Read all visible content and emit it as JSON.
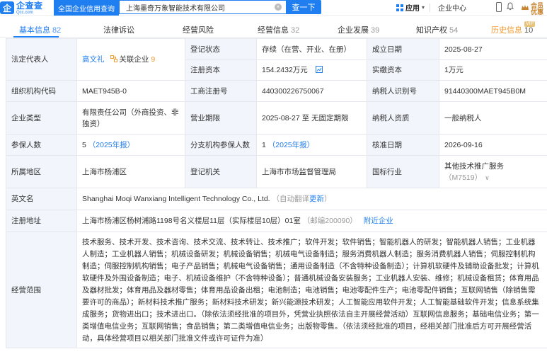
{
  "header": {
    "logo_mark": "企",
    "logo_name": "企查查",
    "logo_domain": "Qcc.com",
    "slogan": "全国企业信用查询",
    "search_value": "上海墨奇万象智能技术有限公司",
    "search_button": "查一下",
    "apps_label": "应用",
    "enterprise_center": "企业中心",
    "vip_top": "会员",
    "vip_bottom": "优惠"
  },
  "tabs": [
    {
      "label": "基本信息",
      "count": "82"
    },
    {
      "label": "法律诉讼",
      "count": ""
    },
    {
      "label": "经营风险",
      "count": ""
    },
    {
      "label": "经营信息",
      "count": "32"
    },
    {
      "label": "企业发展",
      "count": "39"
    },
    {
      "label": "知识产权",
      "count": "54"
    },
    {
      "label": "历史信息",
      "count": "10"
    }
  ],
  "vip_badge": "VIP",
  "info": {
    "legal_rep_label": "法定代表人",
    "legal_rep_name": "高文礼",
    "related_label": "关联企业",
    "related_count": "9",
    "reg_status_label": "登记状态",
    "reg_status": "存续（在营、开业、在册）",
    "est_date_label": "成立日期",
    "est_date": "2025-08-27",
    "reg_capital_label": "注册资本",
    "reg_capital": "154.2432万元",
    "paid_capital_label": "实缴资本",
    "paid_capital": "1万元",
    "org_code_label": "组织机构代码",
    "org_code": "MAET945B-0",
    "biz_reg_no_label": "工商注册号",
    "biz_reg_no": "440300226750067",
    "taxpayer_id_label": "纳税人识别号",
    "taxpayer_id": "91440300MAET945B0M",
    "company_type_label": "企业类型",
    "company_type": "有限责任公司（外商投资、非独资）",
    "biz_term_label": "营业期限",
    "biz_term": "2025-08-27 至 无固定期限",
    "taxpayer_qual_label": "纳税人资质",
    "taxpayer_qual": "一般纳税人",
    "insured_label": "参保人数",
    "insured": "5",
    "insured_year": "（2025年报）",
    "branch_insured_label": "分支机构参保人数",
    "branch_insured": "1",
    "branch_insured_year": "（2025年报）",
    "approve_date_label": "核准日期",
    "approve_date": "2026-09-16",
    "region_label": "所属地区",
    "region": "上海市杨浦区",
    "reg_authority_label": "登记机关",
    "reg_authority": "上海市市场监督管理局",
    "industry_label": "国标行业",
    "industry": "其他技术推广服务",
    "industry_code": "（M7519）",
    "en_name_label": "英文名",
    "en_name": "Shanghai Moqi Wanxiang Intelligent Technology Co., Ltd.",
    "auto_translate": "（自动翻译",
    "update_link": "更新",
    "auto_translate_end": "）",
    "address_label": "注册地址",
    "address": "上海市杨浦区杨树浦路1198号名义楼层11层（实际楼层10层）01室",
    "postcode": "（邮编200090）",
    "nearby_link": "附近企业",
    "scope_label": "经营范围",
    "scope": "技术服务、技术开发、技术咨询、技术交流、技术转让、技术推广；软件开发；软件销售；智能机器人的研发；智能机器人销售；工业机器人制造；工业机器人销售；机械设备研发；机械设备销售；机械电气设备制造；服务消费机器人制造；服务消费机器人销售；伺服控制机构制造；伺服控制机构销售；电子产品销售；机械电气设备销售；通用设备制造（不含特种设备制造）；计算机软硬件及辅助设备批发；计算机软硬件及外围设备制造；电子、机械设备维护（不含特种设备）；普通机械设备安装服务；工业机器人安装、维修；机械设备租赁；体育用品及器材批发；体育用品及器材零售；体育用品设备出租；电池制造；电池销售；电池零配件生产；电池零配件销售；互联网销售（除销售需要许可的商品）；新材料技术推广服务；新材料技术研发；新兴能源技术研发；人工智能应用软件开发；人工智能基础软件开发；信息系统集成服务；货物进出口；技术进出口。（除依法须经批准的项目外，凭营业执照依法自主开展经营活动）互联网信息服务；基础电信业务；第一类增值电信业务；互联网销售；食品销售；第二类增值电信业务；出版物零售。（依法须经批准的项目，经相关部门批准后方可开展经营活动，具体经营项目以相关部门批准文件或许可证件为准）"
  }
}
